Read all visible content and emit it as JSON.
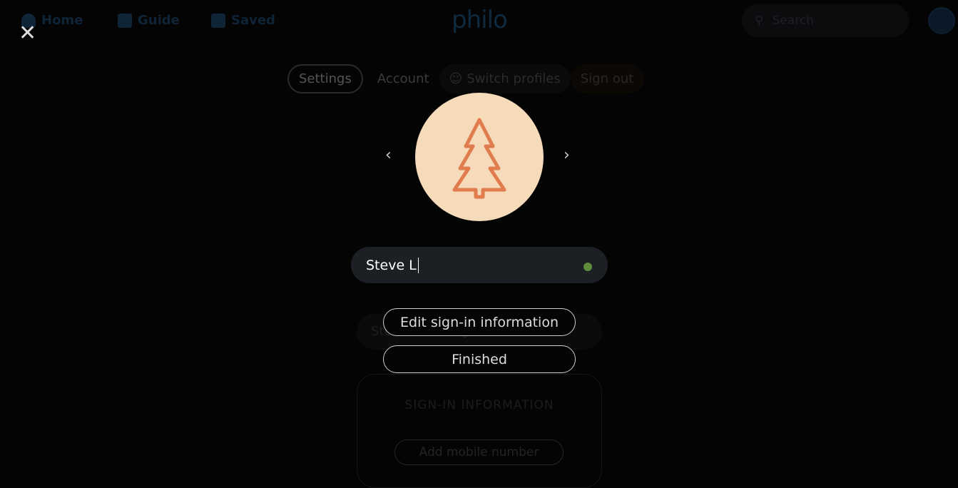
{
  "nav": {
    "home": "Home",
    "guide": "Guide",
    "saved": "Saved",
    "logo": "philo",
    "search_placeholder": "Search"
  },
  "tabs": {
    "settings": "Settings",
    "account": "Account",
    "switch_profiles": "Switch profiles",
    "sign_out": "Sign out"
  },
  "profile": {
    "avatar_icon": "tree-icon",
    "avatar_bg": "#f6dbbb",
    "icon_color": "#e07c4d",
    "name_value": "Steve L",
    "status_color": "#5d8c3a",
    "background_name": "Stephen Lovely"
  },
  "buttons": {
    "edit_signin": "Edit sign-in information",
    "finished": "Finished"
  },
  "card": {
    "title": "SIGN-IN INFORMATION",
    "add_mobile": "Add mobile number"
  }
}
